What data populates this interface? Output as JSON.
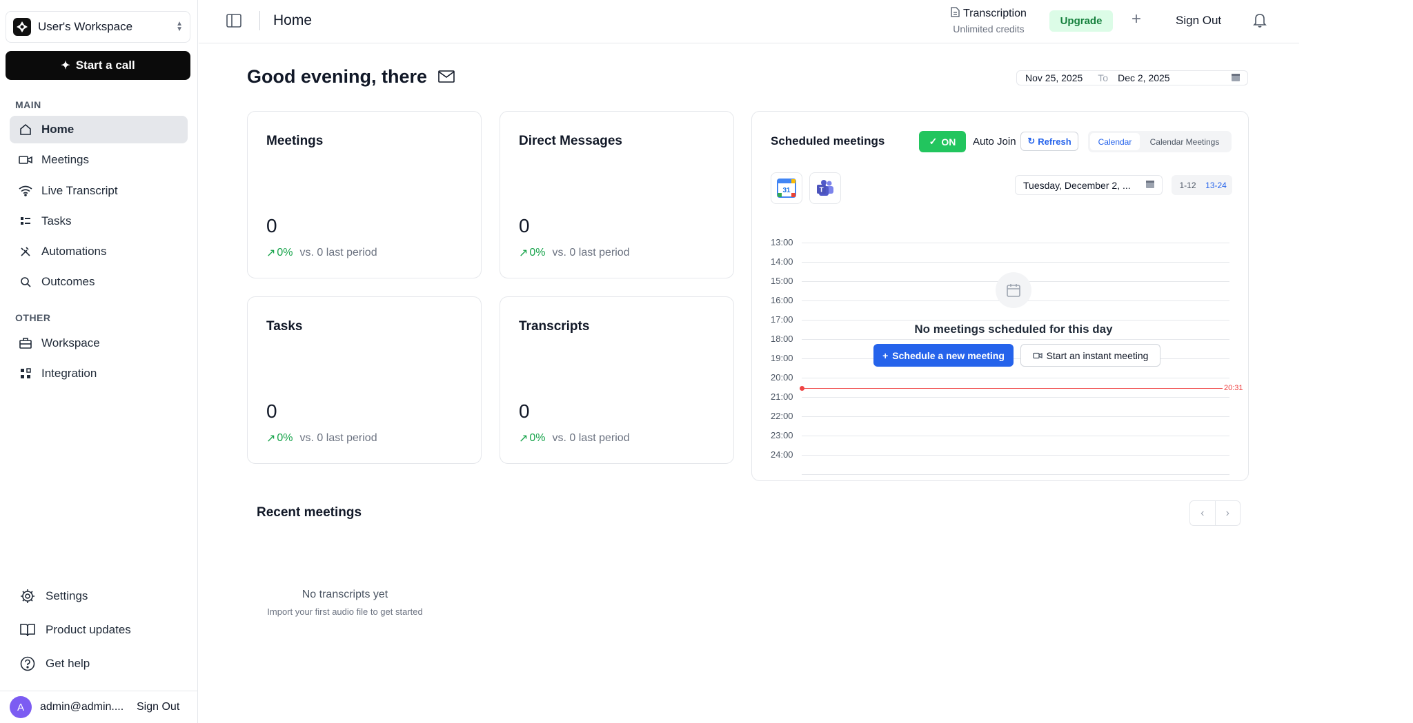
{
  "workspace": {
    "name": "User's Workspace"
  },
  "sidebar": {
    "start_call": "Start a call",
    "main_label": "MAIN",
    "other_label": "OTHER",
    "main_items": [
      {
        "label": "Home",
        "icon": "home-icon"
      },
      {
        "label": "Meetings",
        "icon": "video-icon"
      },
      {
        "label": "Live Transcript",
        "icon": "wifi-icon"
      },
      {
        "label": "Tasks",
        "icon": "list-icon"
      },
      {
        "label": "Automations",
        "icon": "tools-icon"
      },
      {
        "label": "Outcomes",
        "icon": "search-icon"
      }
    ],
    "other_items": [
      {
        "label": "Workspace",
        "icon": "briefcase-icon"
      },
      {
        "label": "Integration",
        "icon": "grid-icon"
      }
    ],
    "bottom_items": [
      {
        "label": "Settings",
        "icon": "gear-icon"
      },
      {
        "label": "Product updates",
        "icon": "book-icon"
      },
      {
        "label": "Get help",
        "icon": "help-icon"
      }
    ],
    "user": {
      "initial": "A",
      "email": "admin@admin....",
      "sign_out": "Sign Out"
    }
  },
  "topbar": {
    "title": "Home",
    "plan_name": "Transcription",
    "plan_sub": "Unlimited credits",
    "upgrade": "Upgrade",
    "plus": "+",
    "sign_out": "Sign Out"
  },
  "main": {
    "greeting": "Good evening, there",
    "date_from": "Nov 25, 2025",
    "date_to_label": "To",
    "date_to": "Dec 2, 2025",
    "stats": [
      {
        "title": "Meetings",
        "value": "0",
        "pct": "0%",
        "compare": "vs. 0 last period"
      },
      {
        "title": "Direct Messages",
        "value": "0",
        "pct": "0%",
        "compare": "vs. 0 last period"
      },
      {
        "title": "Tasks",
        "value": "0",
        "pct": "0%",
        "compare": "vs. 0 last period"
      },
      {
        "title": "Transcripts",
        "value": "0",
        "pct": "0%",
        "compare": "vs. 0 last period"
      }
    ]
  },
  "scheduled": {
    "title": "Scheduled meetings",
    "on": "ON",
    "auto_join": "Auto Join",
    "refresh": "Refresh",
    "tab_calendar": "Calendar",
    "tab_calendar_meetings": "Calendar Meetings",
    "google_calendar_day": "31",
    "day": "Tuesday, December 2, ...",
    "half_1": "1-12",
    "half_2": "13-24",
    "hours": [
      "13:00",
      "14:00",
      "15:00",
      "16:00",
      "17:00",
      "18:00",
      "19:00",
      "20:00",
      "21:00",
      "22:00",
      "23:00",
      "24:00"
    ],
    "now": "20:31",
    "empty": "No meetings scheduled for this day",
    "schedule_new": "Schedule a new meeting",
    "instant": "Start an instant meeting"
  },
  "recent": {
    "title": "Recent meetings",
    "empty": "No transcripts yet",
    "empty_sub": "Import your first audio file to get started"
  },
  "colors": {
    "accent": "#2563eb",
    "success": "#22c55e",
    "now_line": "#ef4444"
  }
}
